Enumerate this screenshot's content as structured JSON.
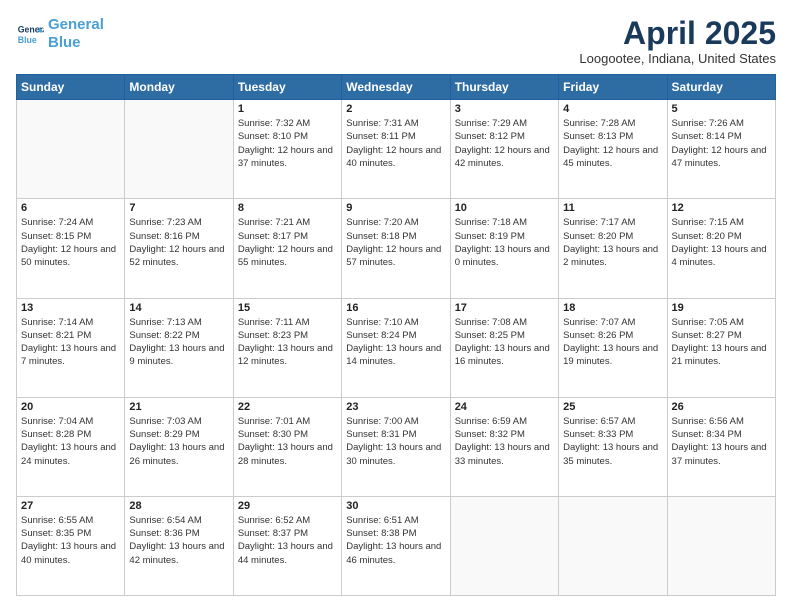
{
  "header": {
    "logo_line1": "General",
    "logo_line2": "Blue",
    "month": "April 2025",
    "location": "Loogootee, Indiana, United States"
  },
  "weekdays": [
    "Sunday",
    "Monday",
    "Tuesday",
    "Wednesday",
    "Thursday",
    "Friday",
    "Saturday"
  ],
  "weeks": [
    [
      {
        "day": "",
        "info": ""
      },
      {
        "day": "",
        "info": ""
      },
      {
        "day": "1",
        "info": "Sunrise: 7:32 AM\nSunset: 8:10 PM\nDaylight: 12 hours and 37 minutes."
      },
      {
        "day": "2",
        "info": "Sunrise: 7:31 AM\nSunset: 8:11 PM\nDaylight: 12 hours and 40 minutes."
      },
      {
        "day": "3",
        "info": "Sunrise: 7:29 AM\nSunset: 8:12 PM\nDaylight: 12 hours and 42 minutes."
      },
      {
        "day": "4",
        "info": "Sunrise: 7:28 AM\nSunset: 8:13 PM\nDaylight: 12 hours and 45 minutes."
      },
      {
        "day": "5",
        "info": "Sunrise: 7:26 AM\nSunset: 8:14 PM\nDaylight: 12 hours and 47 minutes."
      }
    ],
    [
      {
        "day": "6",
        "info": "Sunrise: 7:24 AM\nSunset: 8:15 PM\nDaylight: 12 hours and 50 minutes."
      },
      {
        "day": "7",
        "info": "Sunrise: 7:23 AM\nSunset: 8:16 PM\nDaylight: 12 hours and 52 minutes."
      },
      {
        "day": "8",
        "info": "Sunrise: 7:21 AM\nSunset: 8:17 PM\nDaylight: 12 hours and 55 minutes."
      },
      {
        "day": "9",
        "info": "Sunrise: 7:20 AM\nSunset: 8:18 PM\nDaylight: 12 hours and 57 minutes."
      },
      {
        "day": "10",
        "info": "Sunrise: 7:18 AM\nSunset: 8:19 PM\nDaylight: 13 hours and 0 minutes."
      },
      {
        "day": "11",
        "info": "Sunrise: 7:17 AM\nSunset: 8:20 PM\nDaylight: 13 hours and 2 minutes."
      },
      {
        "day": "12",
        "info": "Sunrise: 7:15 AM\nSunset: 8:20 PM\nDaylight: 13 hours and 4 minutes."
      }
    ],
    [
      {
        "day": "13",
        "info": "Sunrise: 7:14 AM\nSunset: 8:21 PM\nDaylight: 13 hours and 7 minutes."
      },
      {
        "day": "14",
        "info": "Sunrise: 7:13 AM\nSunset: 8:22 PM\nDaylight: 13 hours and 9 minutes."
      },
      {
        "day": "15",
        "info": "Sunrise: 7:11 AM\nSunset: 8:23 PM\nDaylight: 13 hours and 12 minutes."
      },
      {
        "day": "16",
        "info": "Sunrise: 7:10 AM\nSunset: 8:24 PM\nDaylight: 13 hours and 14 minutes."
      },
      {
        "day": "17",
        "info": "Sunrise: 7:08 AM\nSunset: 8:25 PM\nDaylight: 13 hours and 16 minutes."
      },
      {
        "day": "18",
        "info": "Sunrise: 7:07 AM\nSunset: 8:26 PM\nDaylight: 13 hours and 19 minutes."
      },
      {
        "day": "19",
        "info": "Sunrise: 7:05 AM\nSunset: 8:27 PM\nDaylight: 13 hours and 21 minutes."
      }
    ],
    [
      {
        "day": "20",
        "info": "Sunrise: 7:04 AM\nSunset: 8:28 PM\nDaylight: 13 hours and 24 minutes."
      },
      {
        "day": "21",
        "info": "Sunrise: 7:03 AM\nSunset: 8:29 PM\nDaylight: 13 hours and 26 minutes."
      },
      {
        "day": "22",
        "info": "Sunrise: 7:01 AM\nSunset: 8:30 PM\nDaylight: 13 hours and 28 minutes."
      },
      {
        "day": "23",
        "info": "Sunrise: 7:00 AM\nSunset: 8:31 PM\nDaylight: 13 hours and 30 minutes."
      },
      {
        "day": "24",
        "info": "Sunrise: 6:59 AM\nSunset: 8:32 PM\nDaylight: 13 hours and 33 minutes."
      },
      {
        "day": "25",
        "info": "Sunrise: 6:57 AM\nSunset: 8:33 PM\nDaylight: 13 hours and 35 minutes."
      },
      {
        "day": "26",
        "info": "Sunrise: 6:56 AM\nSunset: 8:34 PM\nDaylight: 13 hours and 37 minutes."
      }
    ],
    [
      {
        "day": "27",
        "info": "Sunrise: 6:55 AM\nSunset: 8:35 PM\nDaylight: 13 hours and 40 minutes."
      },
      {
        "day": "28",
        "info": "Sunrise: 6:54 AM\nSunset: 8:36 PM\nDaylight: 13 hours and 42 minutes."
      },
      {
        "day": "29",
        "info": "Sunrise: 6:52 AM\nSunset: 8:37 PM\nDaylight: 13 hours and 44 minutes."
      },
      {
        "day": "30",
        "info": "Sunrise: 6:51 AM\nSunset: 8:38 PM\nDaylight: 13 hours and 46 minutes."
      },
      {
        "day": "",
        "info": ""
      },
      {
        "day": "",
        "info": ""
      },
      {
        "day": "",
        "info": ""
      }
    ]
  ]
}
